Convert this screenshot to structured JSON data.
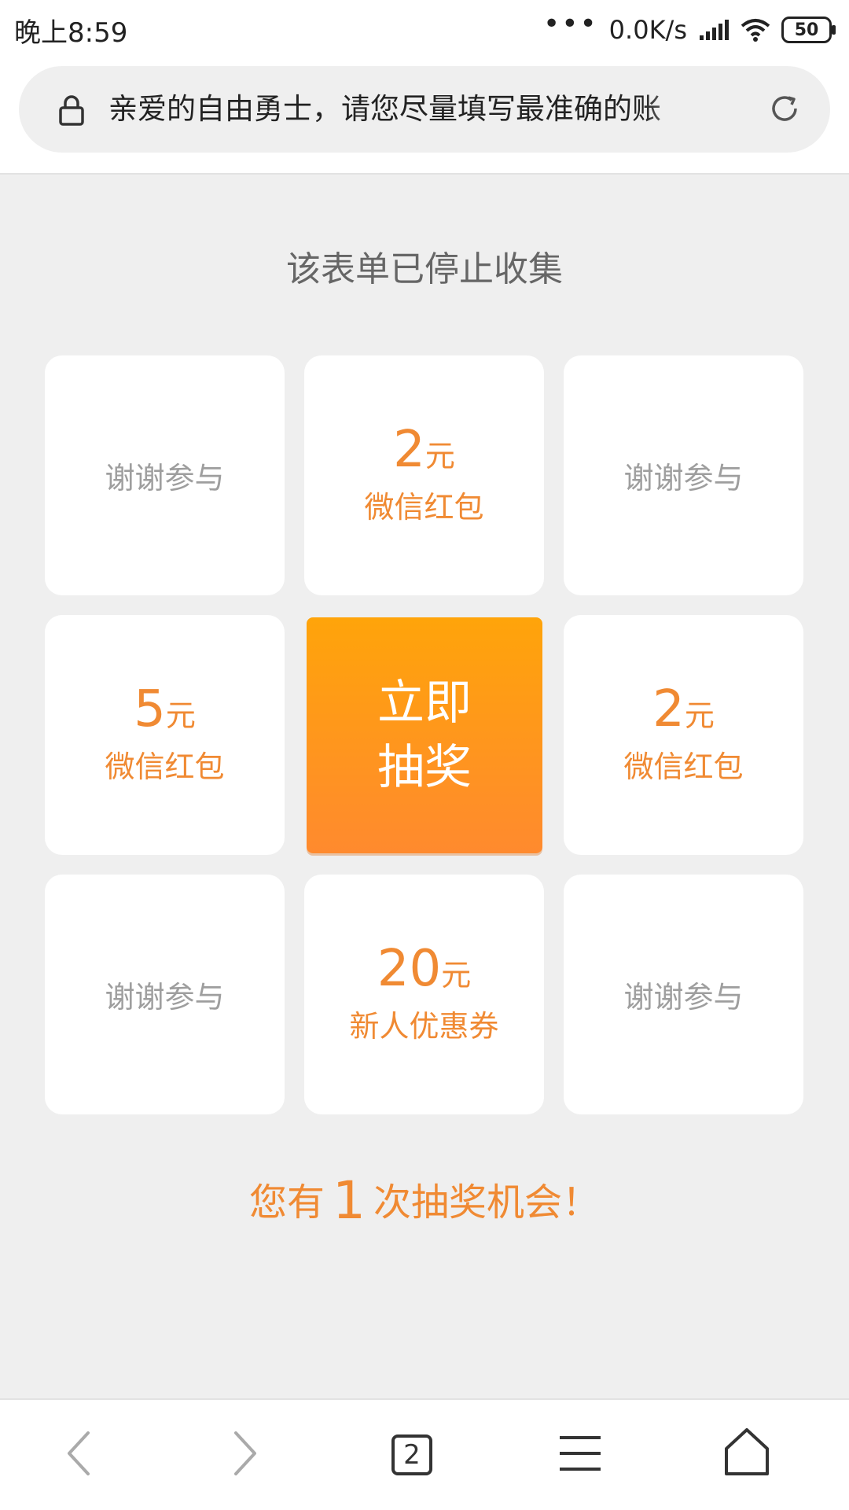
{
  "status_bar": {
    "time": "晚上8:59",
    "dots": "•••",
    "net_speed": "0.0K/s",
    "battery": "50"
  },
  "address_bar": {
    "url_text": "亲爱的自由勇士，请您尽量填写最准确的账"
  },
  "main": {
    "notice": "该表单已停止收集",
    "draw_button": {
      "line1": "立即",
      "line2": "抽奖"
    },
    "prizes": [
      {
        "type": "thanks",
        "text": "谢谢参与"
      },
      {
        "type": "prize",
        "amount": "2",
        "unit": "元",
        "name": "微信红包"
      },
      {
        "type": "thanks",
        "text": "谢谢参与"
      },
      {
        "type": "prize",
        "amount": "5",
        "unit": "元",
        "name": "微信红包"
      },
      {
        "type": "prize",
        "amount": "2",
        "unit": "元",
        "name": "微信红包"
      },
      {
        "type": "thanks",
        "text": "谢谢参与"
      },
      {
        "type": "prize",
        "amount": "20",
        "unit": "元",
        "name": "新人优惠券"
      },
      {
        "type": "thanks",
        "text": "谢谢参与"
      }
    ],
    "chances": {
      "prefix": "您有",
      "count": "1",
      "suffix": "次抽奖机会！"
    }
  },
  "bottom_nav": {
    "tab_count": "2"
  },
  "colors": {
    "accent": "#f08a33",
    "button_top": "#ffa40a",
    "button_bottom": "#ff8a2e",
    "background": "#efefef"
  }
}
